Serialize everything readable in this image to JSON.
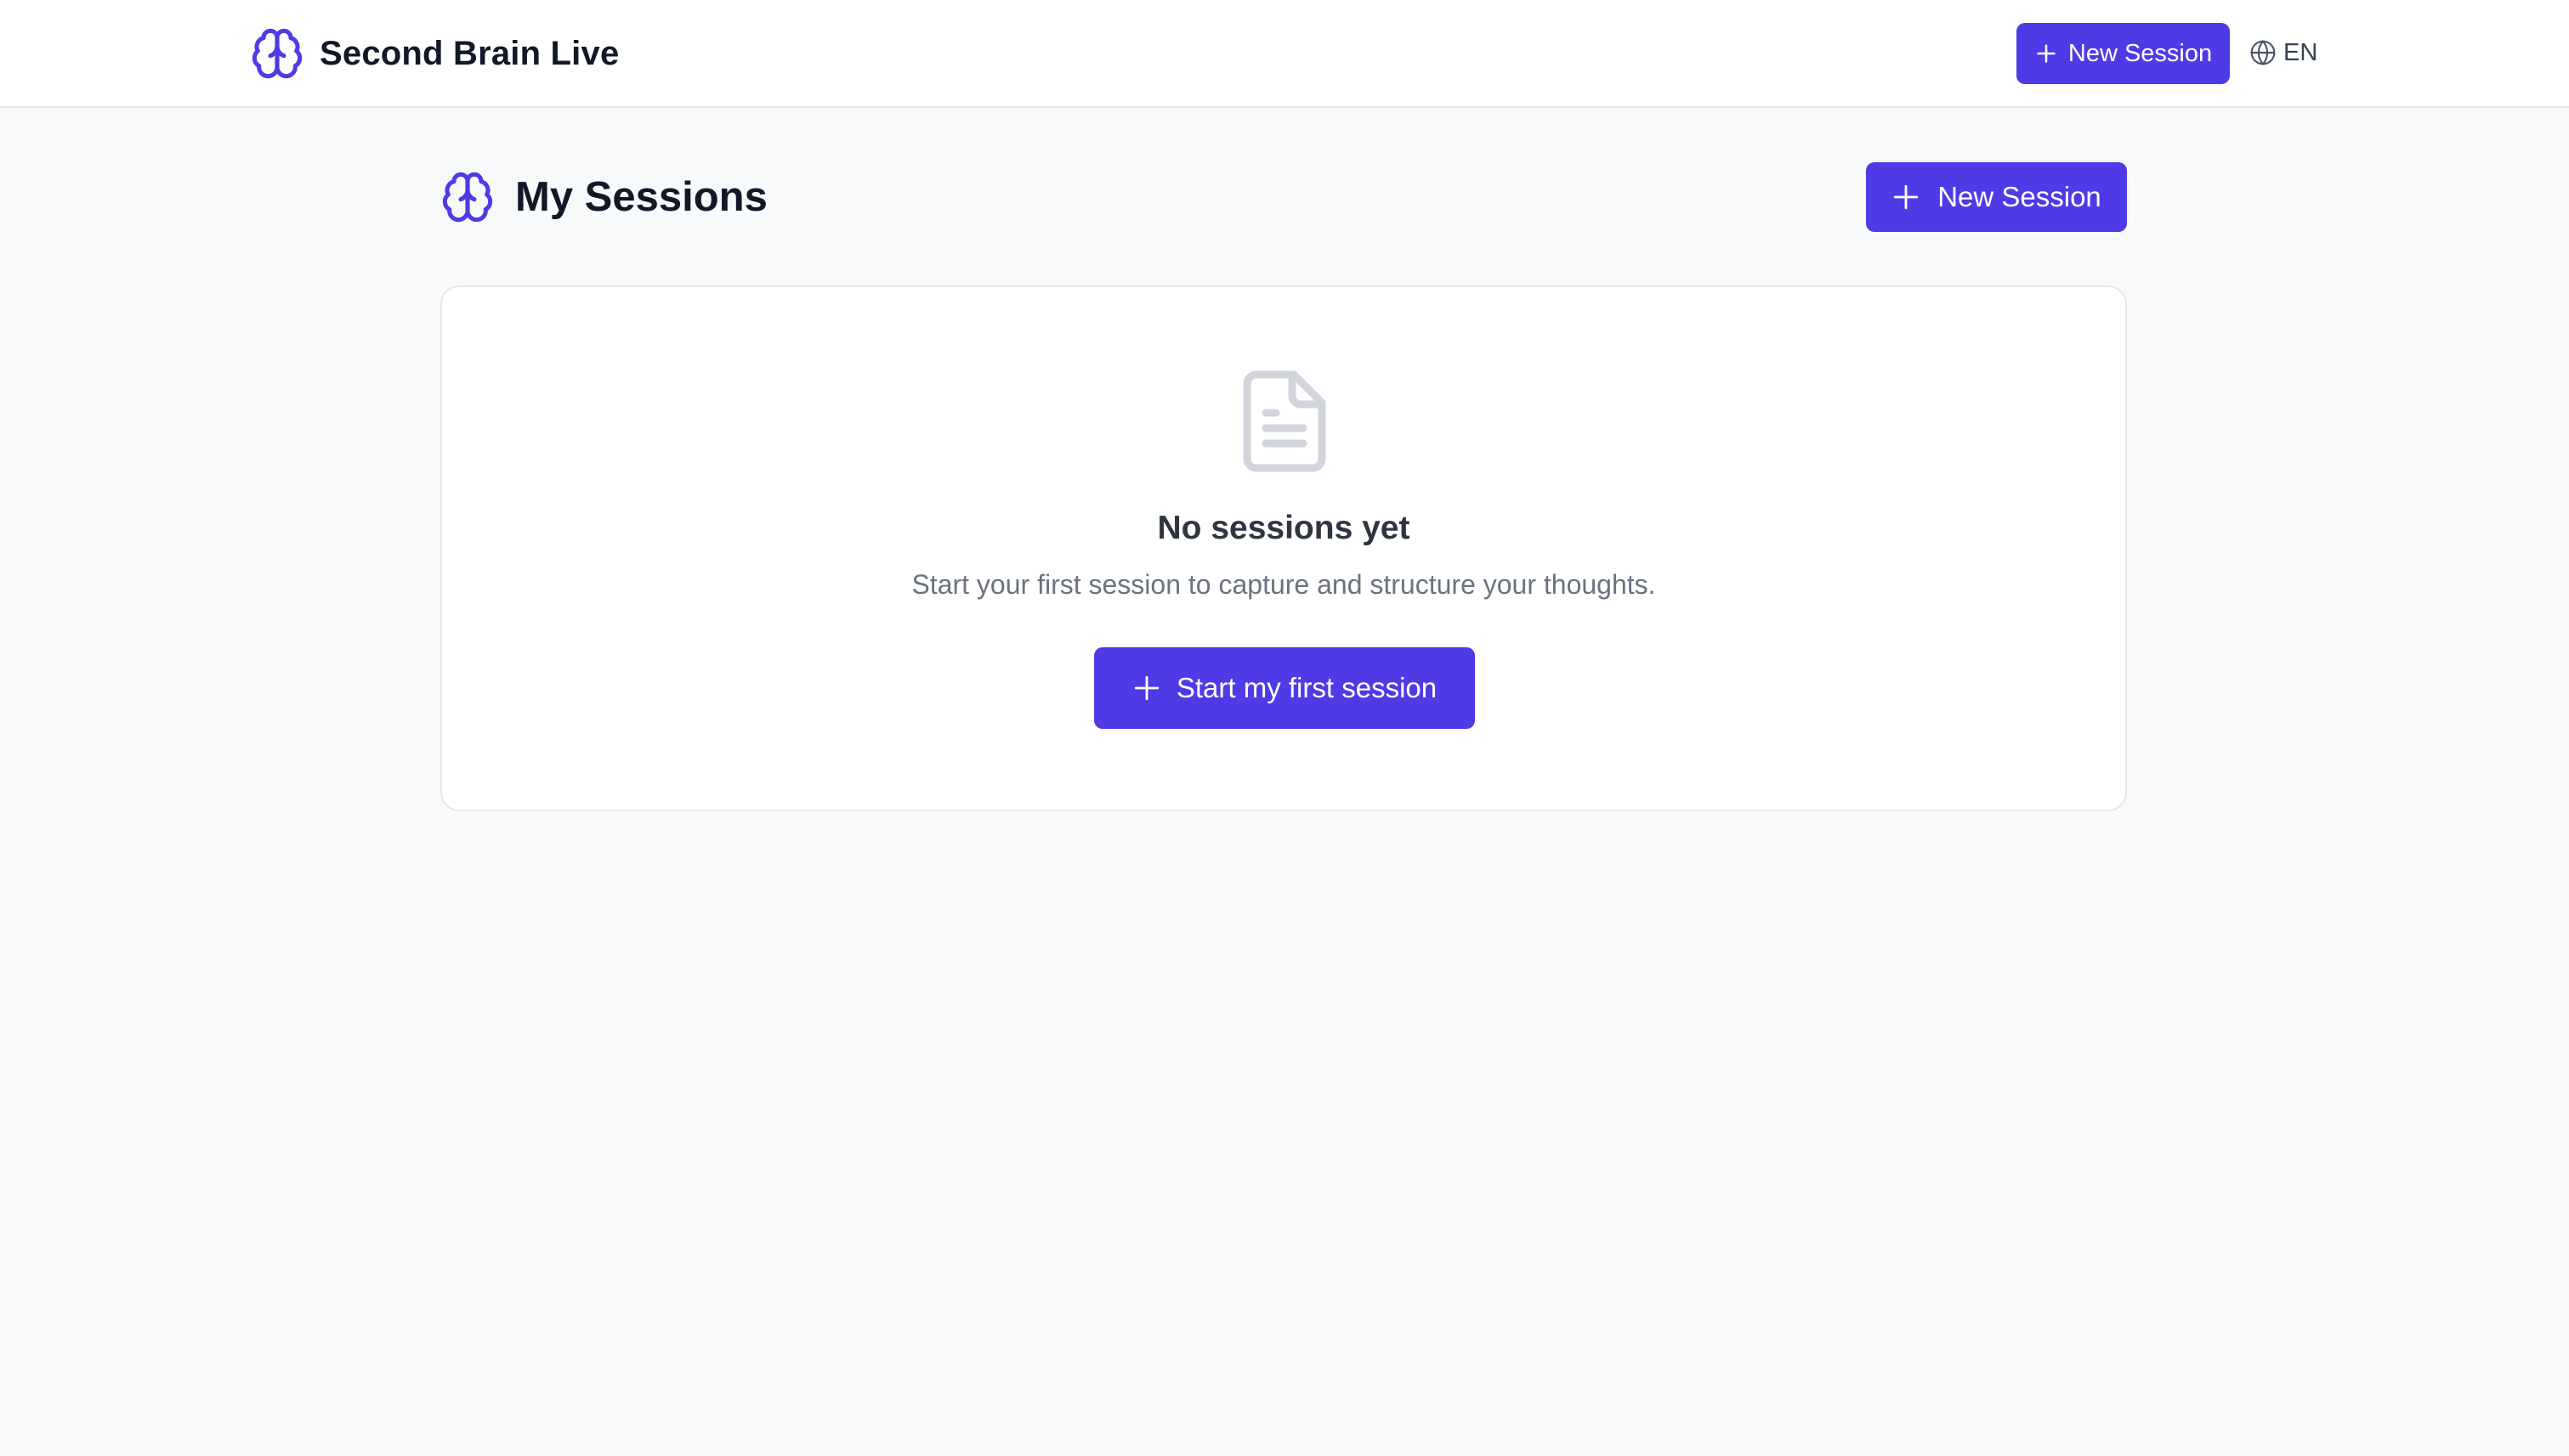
{
  "app": {
    "title": "Second Brain Live",
    "accent_color": "#4f3be6",
    "logo_icon": "brain-icon"
  },
  "topbar": {
    "new_session_label": "New Session",
    "new_session_icon": "plus-icon",
    "language_icon": "globe-icon",
    "language_label": "EN"
  },
  "page": {
    "title": "My Sessions",
    "title_icon": "brain-icon",
    "new_session_label": "New Session",
    "new_session_icon": "plus-icon"
  },
  "empty_state": {
    "icon": "document-icon",
    "title": "No sessions yet",
    "description": "Start your first session to capture and structure your thoughts.",
    "cta_label": "Start my first session",
    "cta_icon": "plus-icon"
  }
}
